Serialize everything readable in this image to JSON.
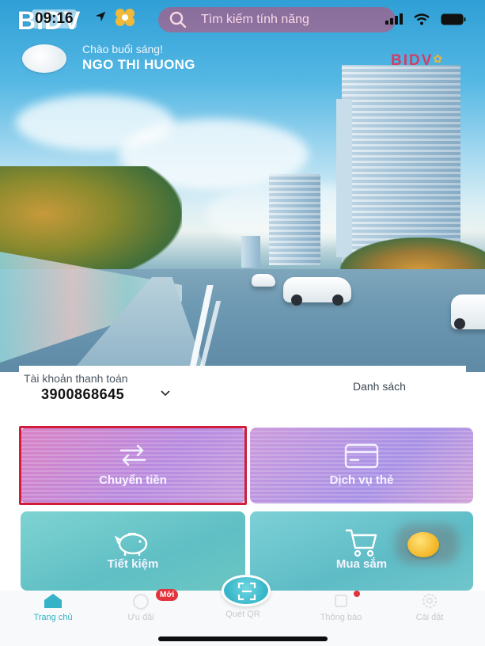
{
  "status_bar": {
    "brand": "BIDV",
    "time": "09:16",
    "search_placeholder": "Tìm kiếm tính năng",
    "icons": [
      "location-arrow-icon",
      "signal-icon",
      "wifi-icon",
      "battery-icon"
    ]
  },
  "greeting": {
    "hello": "Chào buổi sáng!",
    "name": "NGO THI HUONG",
    "banner_brand": "BIDV"
  },
  "account": {
    "label": "Tài khoản thanh toán",
    "number": "3900868645",
    "list_link": "Danh sách"
  },
  "tiles": [
    {
      "label": "Chuyển tiền",
      "icon": "transfer-arrows-icon",
      "color": "#c98ad8"
    },
    {
      "label": "Dịch vụ thẻ",
      "icon": "credit-card-icon",
      "color": "#b592e3"
    },
    {
      "label": "Tiết kiệm",
      "icon": "piggy-bank-icon",
      "color": "#68c6c8"
    },
    {
      "label": "Mua sắm",
      "icon": "shopping-cart-icon",
      "color": "#68c2ca"
    }
  ],
  "bottom_nav": {
    "items": [
      {
        "label": "Trang chủ",
        "icon": "home-icon"
      },
      {
        "label": "Ưu đãi",
        "icon": "gift-icon"
      },
      {
        "label": "Quét QR",
        "icon": "qr-scan-icon"
      },
      {
        "label": "Thông báo",
        "icon": "bell-icon"
      },
      {
        "label": "Cài đặt",
        "icon": "gear-icon"
      }
    ],
    "new_badge": "Mới"
  },
  "colors": {
    "brand_red": "#d01e3a",
    "brand_teal": "#36b3c6",
    "highlight_border": "#d01e3a"
  }
}
